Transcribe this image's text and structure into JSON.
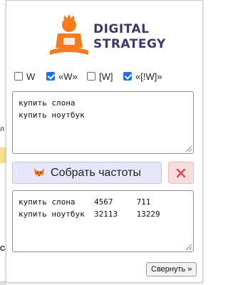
{
  "brand": {
    "line1": "DIGITAL",
    "line2": "STRATEGY",
    "accent": "#f47b20",
    "text_color": "#3b3a63"
  },
  "options": [
    {
      "label": "W",
      "checked": false
    },
    {
      "label": "«W»",
      "checked": true
    },
    {
      "label": "[W]",
      "checked": false
    },
    {
      "label": "«[!W]»",
      "checked": true
    }
  ],
  "input": {
    "lines": [
      "купить слона",
      "купить ноутбук"
    ]
  },
  "collect_button": {
    "label": "Собрать частоты",
    "icon": "fox-icon"
  },
  "clear_button": {
    "icon": "close-icon",
    "color": "#d94f4f"
  },
  "output": {
    "lines": [
      "купить слона    4567     711",
      "купить ноутбук  32113    13229"
    ]
  },
  "collapse_button": {
    "label": "Свернуть »"
  },
  "background_page": {
    "fragment_1": "л",
    "fragment_2": "Cc"
  }
}
